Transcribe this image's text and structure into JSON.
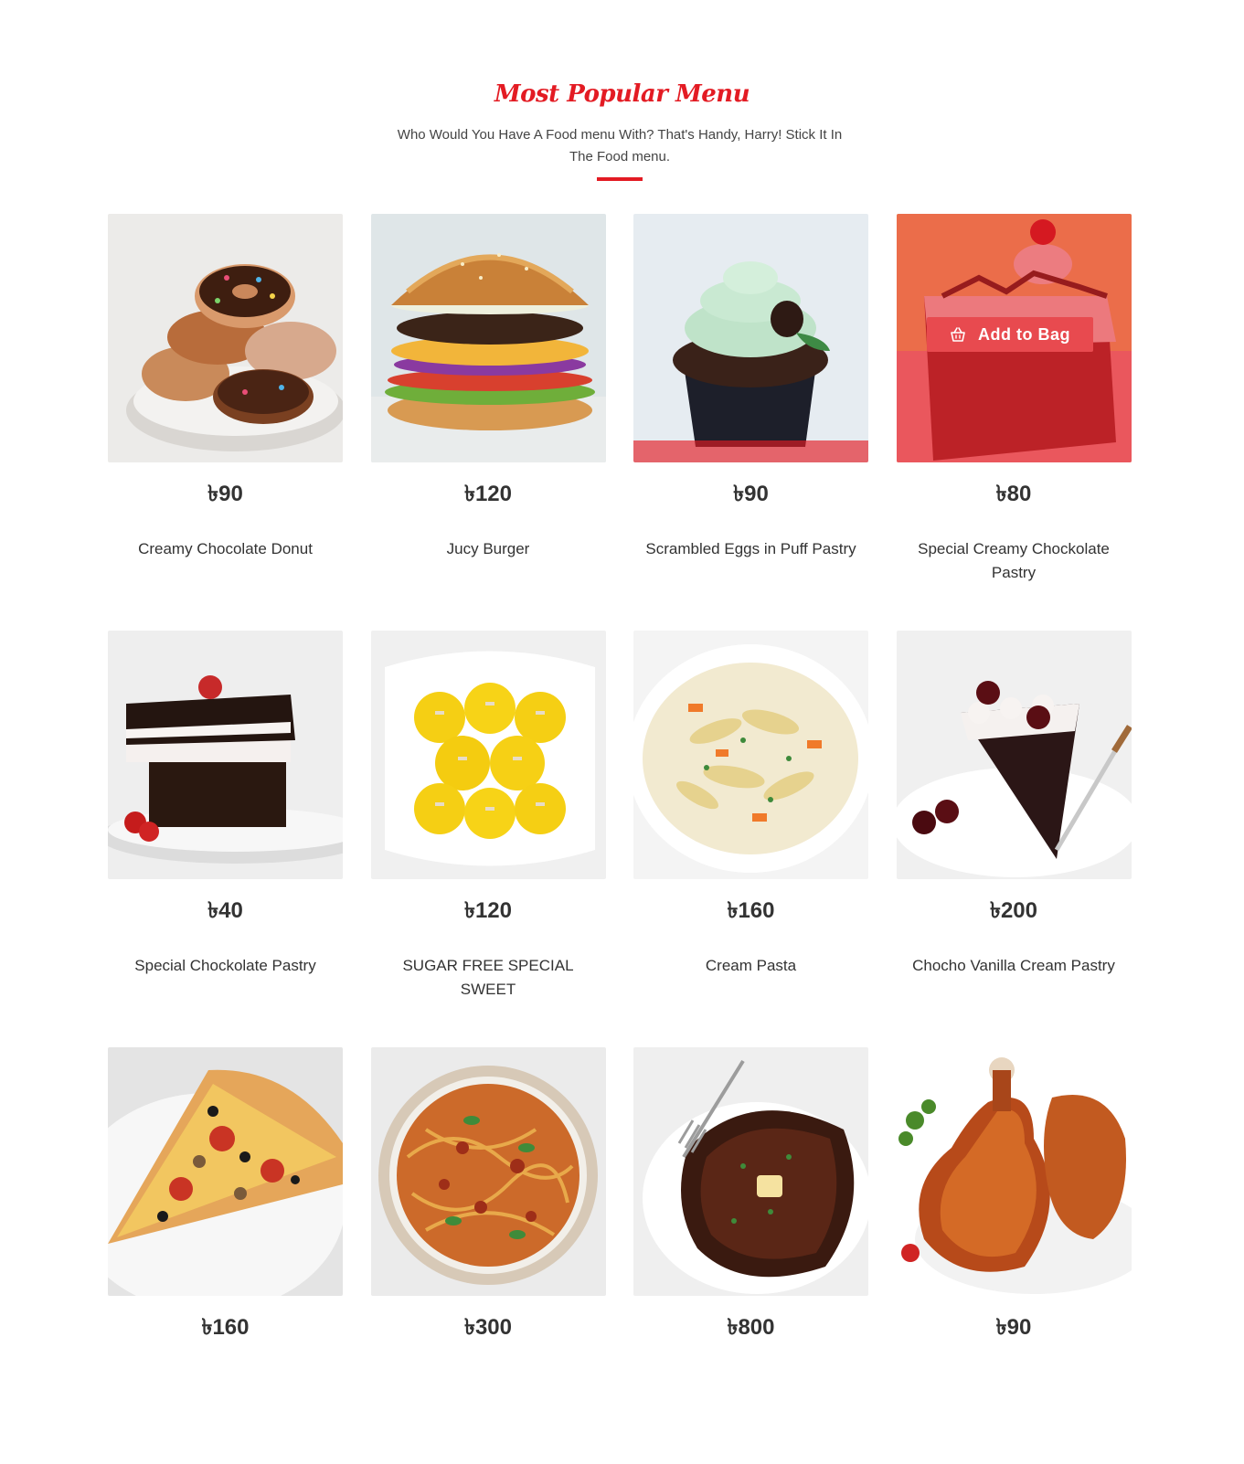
{
  "section": {
    "title": "Most Popular Menu",
    "subtitle": "Who Would You Have A Food menu With? That's Handy, Harry! Stick It In The Food menu.",
    "accent_color": "#e31b23"
  },
  "currency_symbol": "৳",
  "add_to_bag_label": "Add to Bag",
  "items": [
    {
      "price": "90",
      "name": "Creamy Chocolate Donut",
      "icon": "donut-image"
    },
    {
      "price": "120",
      "name": "Jucy Burger",
      "icon": "burger-image"
    },
    {
      "price": "90",
      "name": "Scrambled Eggs in Puff Pastry",
      "icon": "cupcake-image"
    },
    {
      "price": "80",
      "name": "Special Creamy Chockolate Pastry",
      "icon": "cake-slice-image"
    },
    {
      "price": "40",
      "name": "Special Chockolate Pastry",
      "icon": "chocolate-cake-image"
    },
    {
      "price": "120",
      "name": "SUGAR FREE SPECIAL SWEET",
      "icon": "sweets-image"
    },
    {
      "price": "160",
      "name": "Cream Pasta",
      "icon": "pasta-bowl-image"
    },
    {
      "price": "200",
      "name": "Chocho Vanilla Cream Pastry",
      "icon": "black-forest-cake-image"
    },
    {
      "price": "160",
      "name": "",
      "icon": "pizza-slice-image"
    },
    {
      "price": "300",
      "name": "",
      "icon": "spaghetti-image"
    },
    {
      "price": "800",
      "name": "",
      "icon": "steak-image"
    },
    {
      "price": "90",
      "name": "",
      "icon": "chicken-legs-image"
    }
  ]
}
